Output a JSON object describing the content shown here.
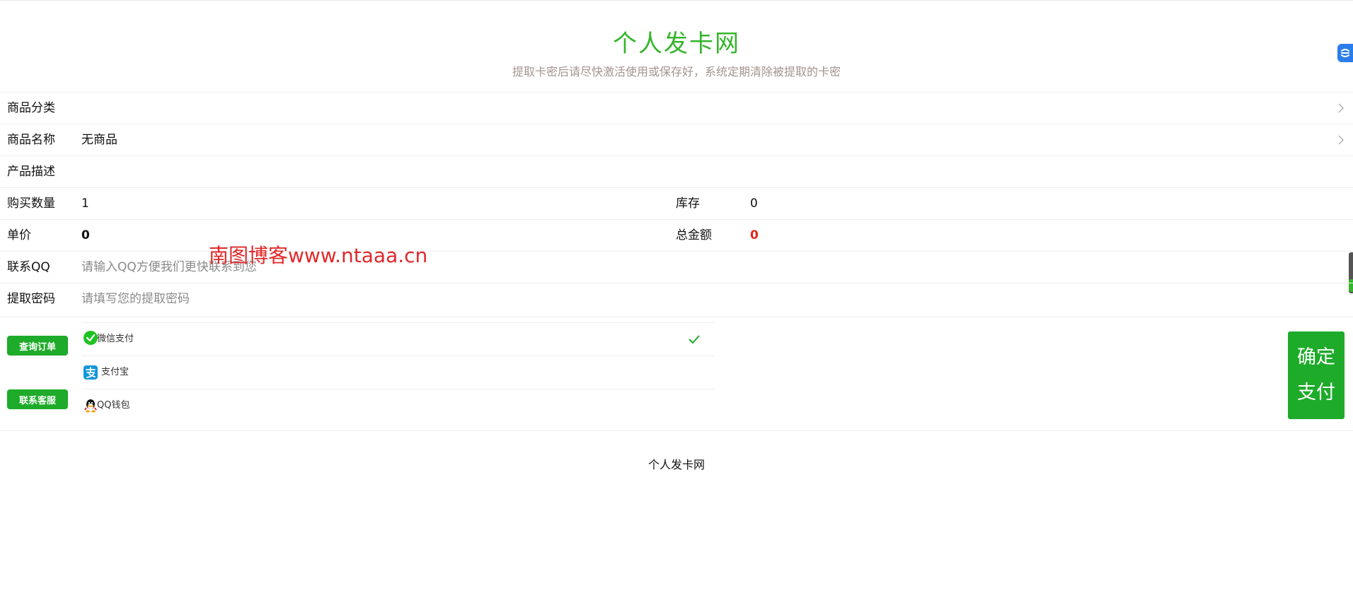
{
  "header": {
    "title": "个人发卡网",
    "subtitle": "提取卡密后请尽快激活使用或保存好，系统定期清除被提取的卡密"
  },
  "form": {
    "category_label": "商品分类",
    "category_value": "",
    "product_label": "商品名称",
    "product_value": "无商品",
    "description_label": "产品描述",
    "description_value": "",
    "quantity_label": "购买数量",
    "quantity_value": "1",
    "stock_label": "库存",
    "stock_value": "0",
    "price_label": "单价",
    "price_value": "0",
    "total_label": "总金额",
    "total_value": "0",
    "qq_label": "联系QQ",
    "qq_placeholder": "请输入QQ方便我们更快联系到您",
    "password_label": "提取密码",
    "password_placeholder": "请填写您的提取密码"
  },
  "watermark": "南图博客www.ntaaa.cn",
  "actions": {
    "query_order": "查询订单",
    "contact_service": "联系客服",
    "confirm_line1": "确定",
    "confirm_line2": "支付"
  },
  "payment_methods": [
    {
      "label": "微信支付",
      "icon": "wechat-icon",
      "selected": true
    },
    {
      "label": "支付宝",
      "icon": "alipay-icon",
      "selected": false
    },
    {
      "label": "QQ钱包",
      "icon": "qq-icon",
      "selected": false
    }
  ],
  "footer": {
    "text": "个人发卡网"
  },
  "colors": {
    "brand_green": "#35b52d",
    "button_green": "#1eab2a",
    "total_red": "#e2231a",
    "subtitle_gray": "#a3948e"
  }
}
